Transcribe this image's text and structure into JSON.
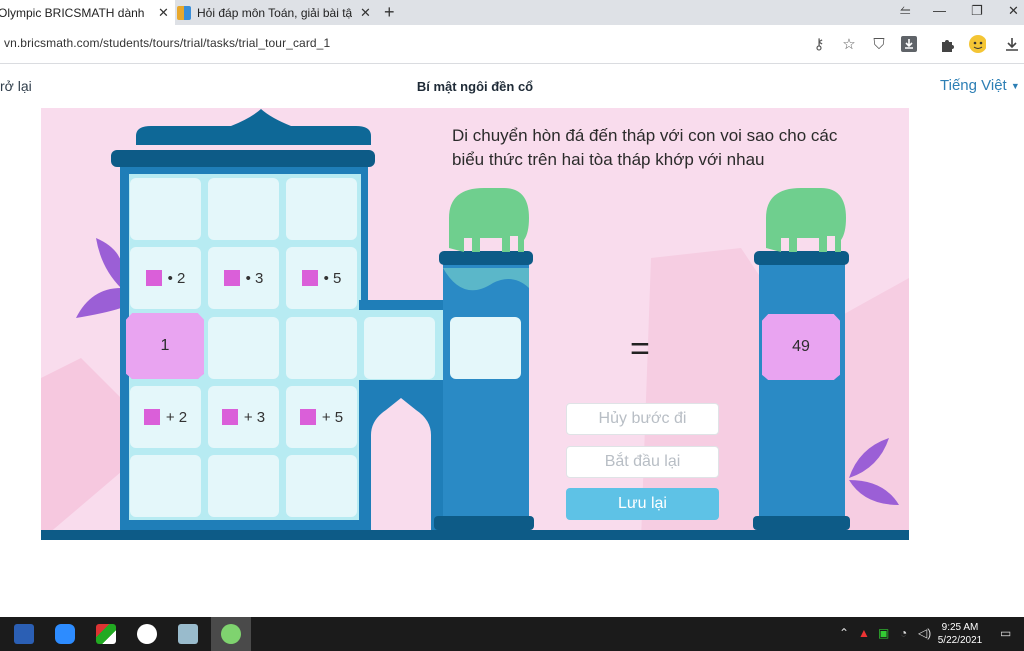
{
  "browser": {
    "tabs": [
      {
        "title": "Olympic BRICSMATH dành ch",
        "active": true
      },
      {
        "title": "Hỏi đáp môn Toán, giải bài tậ",
        "active": false
      }
    ],
    "url": "vn.bricsmath.com/students/tours/trial/tasks/trial_tour_card_1"
  },
  "page": {
    "back_label": "rở lại",
    "title": "Bí mật ngôi đền cổ",
    "language": "Tiếng Việt"
  },
  "game": {
    "instruction": "Di chuyển hòn đá đến tháp với con voi sao cho các biểu thức trên hai tòa tháp khớp với nhau",
    "ops_row1": [
      "• 2",
      "• 3",
      "• 5"
    ],
    "ops_row2": [
      "+ 2",
      "+ 3",
      "+ 5"
    ],
    "stone_value": "1",
    "target_value": "49",
    "equals": "=",
    "buttons": {
      "undo": "Hủy bước đi",
      "restart": "Bắt đầu lại",
      "save": "Lưu lại"
    },
    "colors": {
      "tower": "#2188c2",
      "roof": "#0d5b87",
      "background": "#f9dced",
      "accent_button": "#5ec2e6"
    }
  },
  "taskbar": {
    "time": "9:25 AM",
    "date": "5/22/2021"
  }
}
